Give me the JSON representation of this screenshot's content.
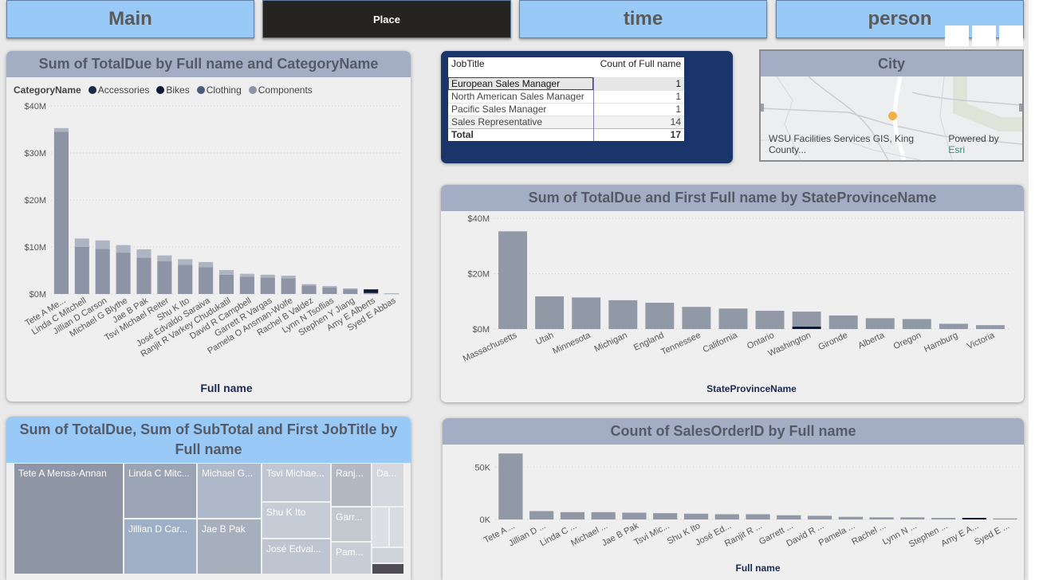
{
  "tabs": [
    {
      "label": "Main"
    },
    {
      "label": "Place"
    },
    {
      "label": "time"
    },
    {
      "label": "person"
    }
  ],
  "chart1": {
    "title": "Sum of TotalDue by Full name and CategoryName",
    "legend_title": "CategoryName",
    "legend": [
      {
        "name": "Accessories",
        "color": "#1b2a4a"
      },
      {
        "name": "Bikes",
        "color": "#0e1a33"
      },
      {
        "name": "Clothing",
        "color": "#4a5a80"
      },
      {
        "name": "Components",
        "color": "#8d94a6"
      }
    ],
    "xlabel": "Full name",
    "y_ticks": [
      "$40M",
      "$30M",
      "$20M",
      "$10M",
      "$0M"
    ]
  },
  "table": {
    "headers": [
      "JobTitle",
      "Count of Full name"
    ],
    "rows": [
      {
        "title": "European Sales Manager",
        "count": "1"
      },
      {
        "title": "North American Sales Manager",
        "count": "1"
      },
      {
        "title": "Pacific Sales Manager",
        "count": "1"
      },
      {
        "title": "Sales Representative",
        "count": "14"
      }
    ],
    "total_label": "Total",
    "total_value": "17"
  },
  "map": {
    "title": "City",
    "attribution": "WSU Facilities Services GIS, King County...",
    "powered_by": "Powered by",
    "powered_brand": "Esri"
  },
  "chart2": {
    "title": "Sum of TotalDue and First Full name by StateProvinceName",
    "xlabel": "StateProvinceName",
    "y_ticks": [
      "$40M",
      "$20M",
      "$0M"
    ]
  },
  "treemap": {
    "title": "Sum of TotalDue, Sum of SubTotal and First JobTitle by Full name",
    "cells": [
      {
        "label": "Tete A Mensa-Annan"
      },
      {
        "label": "Linda C Mitc..."
      },
      {
        "label": "Jillian D Car..."
      },
      {
        "label": "Michael G..."
      },
      {
        "label": "Jae B Pak"
      },
      {
        "label": "Tsvi Michae..."
      },
      {
        "label": "Shu K Ito"
      },
      {
        "label": "José Edval..."
      },
      {
        "label": "Ranj..."
      },
      {
        "label": "Da..."
      },
      {
        "label": "Garr..."
      },
      {
        "label": "Pam..."
      }
    ]
  },
  "chart3": {
    "title": "Count of SalesOrderID by Full name",
    "xlabel": "Full name",
    "y_ticks": [
      "50K",
      "0K"
    ]
  },
  "chart_data": [
    {
      "type": "bar",
      "title": "Sum of TotalDue by Full name and CategoryName",
      "xlabel": "Full name",
      "ylabel": "",
      "ylim": [
        0,
        40
      ],
      "categories": [
        "Tete A Me...",
        "Linda C Mitchell",
        "Jillian D Carson",
        "Michael G Blythe",
        "Jae B Pak",
        "Tsvi Michael Reiter",
        "Shu K Ito",
        "José Edvaldo Saraiva",
        "Ranjit R Varkey Chudukatil",
        "David R Campbell",
        "Garrett R Vargas",
        "Pamela O Ansman-Wolfe",
        "Rachel B Valdez",
        "Lynn N Tsoflias",
        "Stephen Y Jiang",
        "Amy E Alberts",
        "Syed E Abbas"
      ],
      "series": [
        {
          "name": "Components",
          "values": [
            34.5,
            10.0,
            9.6,
            8.8,
            7.7,
            7.0,
            6.2,
            5.7,
            4.1,
            3.7,
            3.5,
            3.3,
            1.8,
            1.4,
            1.0,
            0.1,
            0.1
          ]
        },
        {
          "name": "Clothing",
          "values": [
            0.8,
            1.8,
            1.8,
            1.6,
            1.8,
            1.2,
            1.2,
            1.1,
            1.0,
            0.6,
            0.6,
            0.6,
            0.3,
            0.3,
            0.2,
            0.1,
            0.05
          ]
        },
        {
          "name": "Bikes",
          "values": [
            0,
            0,
            0,
            0,
            0,
            0,
            0,
            0,
            0,
            0,
            0,
            0,
            0,
            0,
            0,
            0.7,
            0
          ]
        },
        {
          "name": "Accessories",
          "values": [
            0,
            0,
            0,
            0,
            0,
            0,
            0,
            0,
            0,
            0,
            0,
            0,
            0,
            0,
            0,
            0.1,
            0
          ]
        }
      ]
    },
    {
      "type": "bar",
      "title": "Sum of TotalDue and First Full name by StateProvinceName",
      "xlabel": "StateProvinceName",
      "ylabel": "",
      "ylim": [
        0,
        40
      ],
      "categories": [
        "Massachusetts",
        "Utah",
        "Minnesota",
        "Michigan",
        "England",
        "Tennessee",
        "California",
        "Ontario",
        "Washington",
        "Gironde",
        "Alberta",
        "Oregon",
        "Hamburg",
        "Victoria"
      ],
      "values": [
        35.3,
        11.8,
        11.4,
        10.4,
        9.5,
        8.0,
        7.4,
        6.6,
        6.3,
        4.9,
        3.9,
        3.6,
        1.9,
        1.4
      ]
    },
    {
      "type": "bar",
      "title": "Count of SalesOrderID by Full name",
      "xlabel": "Full name",
      "ylabel": "",
      "ylim": [
        0,
        70
      ],
      "categories": [
        "Tete A ...",
        "Jillian D ...",
        "Linda C ...",
        "Michael ...",
        "Jae B Pak",
        "Tsvi Mic...",
        "Shu K Ito",
        "José Ed...",
        "Ranjit R ...",
        "Garrett ...",
        "David R ...",
        "Pamela ...",
        "Rachel ...",
        "Lynn N ...",
        "Stephen ...",
        "Amy E A...",
        "Syed E ..."
      ],
      "values": [
        63,
        8,
        7,
        7,
        6.5,
        6,
        5.5,
        5,
        5,
        4,
        3.5,
        2.5,
        2,
        2,
        1.5,
        1,
        1
      ]
    }
  ]
}
